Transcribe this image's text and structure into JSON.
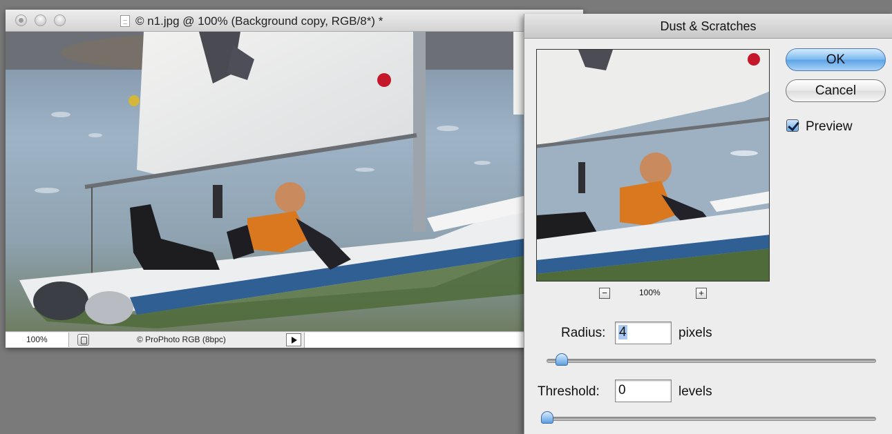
{
  "document_window": {
    "title": "© n1.jpg @ 100% (Background copy, RGB/8*) *",
    "status": {
      "zoom": "100%",
      "profile": "© ProPhoto RGB (8bpc)"
    }
  },
  "dialog": {
    "title": "Dust & Scratches",
    "ok_label": "OK",
    "cancel_label": "Cancel",
    "preview_label": "Preview",
    "preview_checked": true,
    "preview_zoom": "100%",
    "zoom_out_symbol": "−",
    "zoom_in_symbol": "+",
    "radius": {
      "label": "Radius:",
      "value": "4",
      "unit": "pixels"
    },
    "threshold": {
      "label": "Threshold:",
      "value": "0",
      "unit": "levels"
    }
  },
  "icons": {
    "window_controls": [
      "close-icon",
      "minimize-icon",
      "zoom-icon"
    ],
    "document": "document-icon",
    "status": "status-icon",
    "menu": "arrow-right-icon"
  },
  "colors": {
    "accent": "#5aa2e6",
    "dialog_bg": "#ededed",
    "desktop_bg": "#7a7a7a"
  }
}
